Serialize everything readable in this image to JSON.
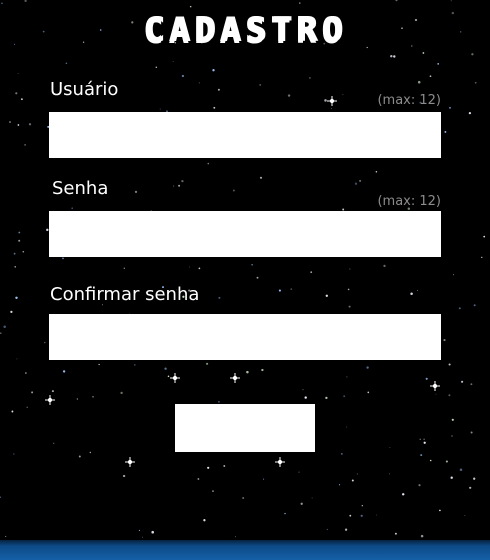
{
  "form": {
    "title": "CADASTRO",
    "fields": [
      {
        "label": "Usuário",
        "hint": "(max: 12)",
        "value": ""
      },
      {
        "label": "Senha",
        "hint": "(max: 12)",
        "value": ""
      },
      {
        "label": "Confirmar senha",
        "value": ""
      }
    ],
    "submit_label": ""
  },
  "colors": {
    "background": "#000000",
    "text": "#ffffff",
    "hint": "#8c8c8c",
    "field": "#ffffff",
    "bottom_bar": "#1560a8"
  }
}
